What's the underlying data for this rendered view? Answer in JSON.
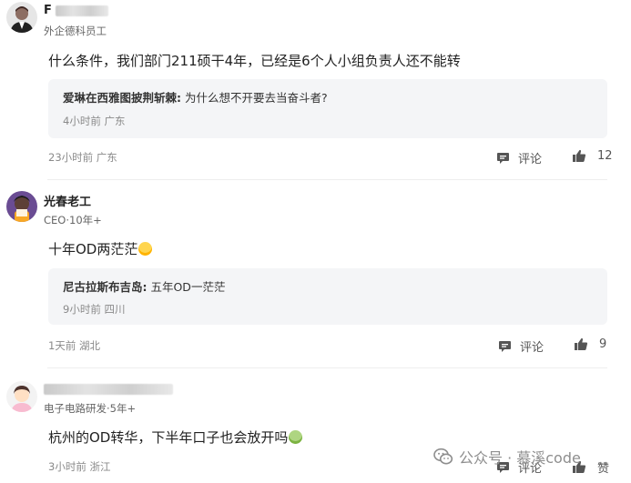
{
  "comments": [
    {
      "username_visible": "F",
      "user_meta": "外企德科员工",
      "text": "什么条件，我们部门211硕干4年，已经是6个人小组负责人还不能转",
      "reply": {
        "author": "爱琳在西雅图披荆斩棘:",
        "text": " 为什么想不开要去当奋斗者?",
        "meta": "4小时前 广东"
      },
      "time_location": "23小时前 广东",
      "comment_label": "评论",
      "like_count": "12"
    },
    {
      "username_visible": "光春老工",
      "user_meta": "CEO·10年+",
      "text": "十年OD两茫茫",
      "reply": {
        "author": "尼古拉斯布吉岛:",
        "text": " 五年OD一茫茫",
        "meta": "9小时前 四川"
      },
      "time_location": "1天前 湖北",
      "comment_label": "评论",
      "like_count": "9"
    },
    {
      "username_visible": "",
      "user_meta": "电子电路研发·5年+",
      "text": "杭州的OD转华，下半年口子也会放开吗",
      "time_location": "3小时前 浙江",
      "comment_label": "评论",
      "like_label": "赞"
    }
  ],
  "watermark": {
    "text": "公众号 · 慕溪code"
  },
  "icons": {
    "comment": "comment-bubble-icon",
    "like": "thumbs-up-icon",
    "wechat": "wechat-icon"
  },
  "colors": {
    "reply_bg": "#f4f5f7",
    "muted": "#8a8a8a"
  }
}
